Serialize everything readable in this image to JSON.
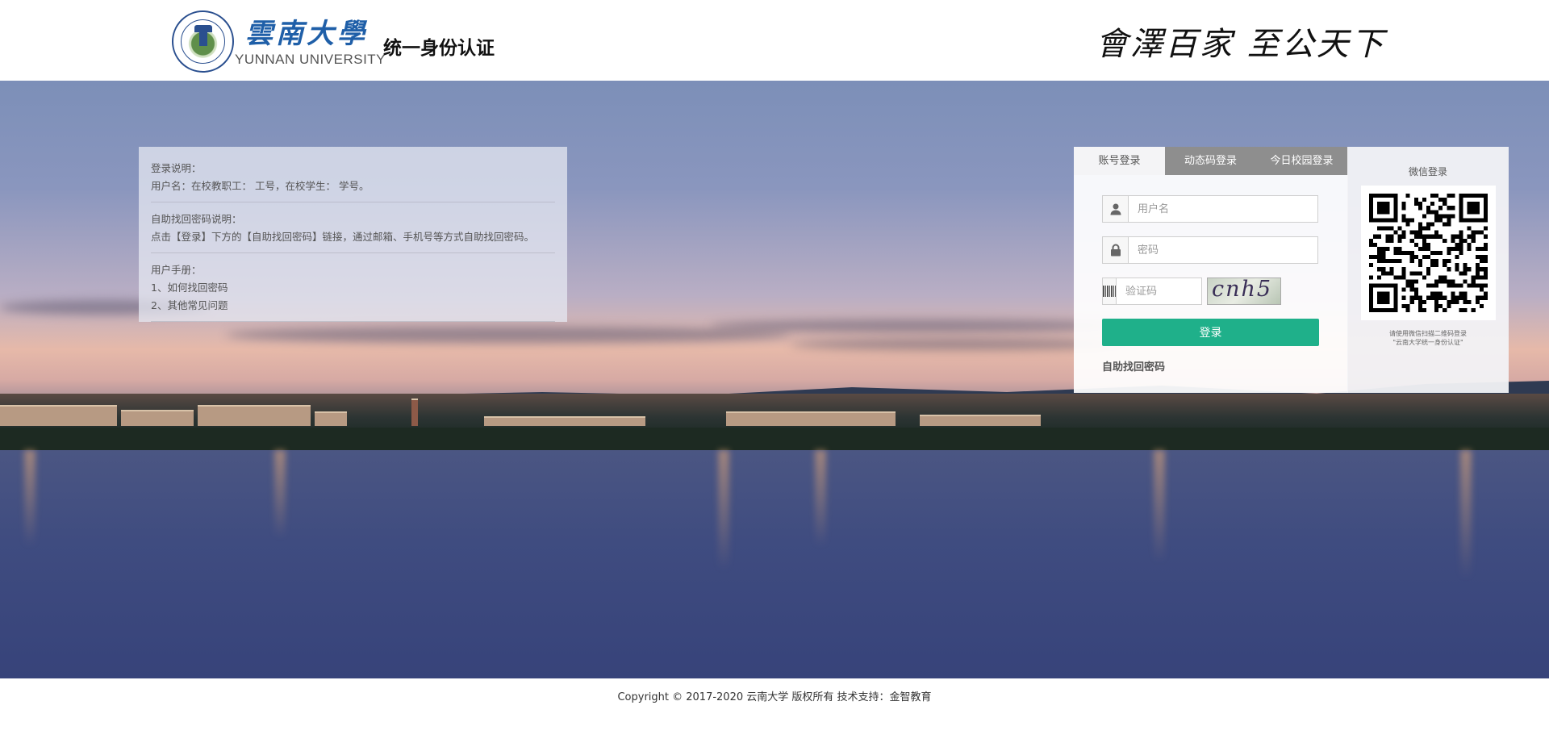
{
  "header": {
    "logo_cn": "雲南大學",
    "logo_en": "YUNNAN UNIVERSITY",
    "system_title": "统一身份认证",
    "motto": "會澤百家 至公天下"
  },
  "info": {
    "sections": [
      {
        "lines": [
          "登录说明：",
          "用户名：在校教职工： 工号，在校学生： 学号。"
        ]
      },
      {
        "lines": [
          "自助找回密码说明：",
          "点击【登录】下方的【自助找回密码】链接，通过邮箱、手机号等方式自助找回密码。"
        ]
      },
      {
        "lines": [
          "用户手册：",
          "1、如何找回密码",
          "2、其他常见问题"
        ]
      }
    ]
  },
  "login": {
    "tabs": [
      "账号登录",
      "动态码登录",
      "今日校园登录"
    ],
    "username_placeholder": "用户名",
    "password_placeholder": "密码",
    "captcha_placeholder": "验证码",
    "captcha_text": "cnh5",
    "submit_label": "登录",
    "forgot_label": "自助找回密码"
  },
  "wechat": {
    "title": "微信登录",
    "hint_line1": "请使用微信扫描二维码登录",
    "hint_line2": "\"云南大学统一身份认证\""
  },
  "footer": {
    "copyright": "Copyright © 2017-2020 云南大学 版权所有 技术支持：金智教育"
  },
  "colors": {
    "accent_green": "#1fb08a",
    "tab_gray": "#8e8e8e",
    "brand_blue": "#1f5fa8"
  },
  "icons": [
    "user-icon",
    "lock-icon",
    "barcode-icon",
    "qr-code-icon"
  ]
}
